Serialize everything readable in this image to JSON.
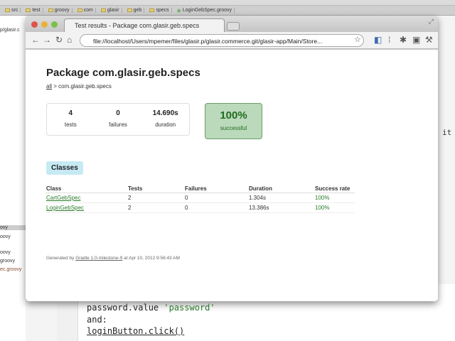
{
  "ide": {
    "breadcrumbs": [
      "src",
      "test",
      "groovy",
      "com",
      "glasir",
      "geb",
      "specs",
      "LoginGebSpec.groovy"
    ],
    "left_panel": [
      "p/glasir.c",
      "ovy",
      "oovy",
      "oovy",
      "groovy",
      "ec.groovy"
    ],
    "right_text": "it",
    "code": {
      "line1_a": "password.value ",
      "line1_b": "'password'",
      "line2": "and:",
      "line3": "loginButton.click()"
    }
  },
  "browser": {
    "tab_title": "Test results - Package com.glasir.geb.specs",
    "url": "file://localhost/Users/mpemer/files/glasir.p/glasir.commerce.git/glasir-app/Main/Store..."
  },
  "page": {
    "title": "Package com.glasir.geb.specs",
    "breadcrumb_all": "all",
    "breadcrumb_rest": " > com.glasir.geb.specs",
    "summary": [
      {
        "value": "4",
        "label": "tests"
      },
      {
        "value": "0",
        "label": "failures"
      },
      {
        "value": "14.690s",
        "label": "duration"
      }
    ],
    "success": {
      "value": "100%",
      "label": "successful"
    },
    "classes_tab": "Classes",
    "table": {
      "headers": [
        "Class",
        "Tests",
        "Failures",
        "Duration",
        "Success rate"
      ],
      "rows": [
        [
          "CartGebSpec",
          "2",
          "0",
          "1.304s",
          "100%"
        ],
        [
          "LoginGebSpec",
          "2",
          "0",
          "13.386s",
          "100%"
        ]
      ]
    },
    "footer": {
      "prefix": "Generated by ",
      "link": "Gradle 1.0-milestone-9",
      "suffix": " at Apr 10, 2012 9:56:43 AM"
    }
  }
}
